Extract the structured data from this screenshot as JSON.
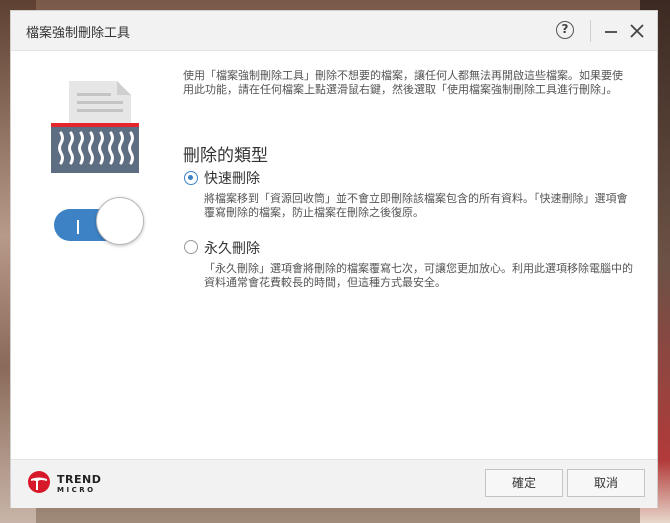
{
  "window": {
    "title": "檔案強制刪除工具"
  },
  "titlebar": {
    "help_glyph": "?",
    "icons": [
      "help-icon",
      "minimize-icon",
      "close-icon"
    ]
  },
  "intro_text": "使用「檔案強制刪除工具」刪除不想要的檔案，讓任何人都無法再開啟這些檔案。如果要使用此功能，請在任何檔案上點選滑鼠右鍵，然後選取「使用檔案強制刪除工具進行刪除」。",
  "deletion_type": {
    "heading": "刪除的類型",
    "options": [
      {
        "label": "快速刪除",
        "description": "將檔案移到「資源回收筒」並不會立即刪除該檔案包含的所有資料。「快速刪除」選項會覆寫刪除的檔案，防止檔案在刪除之後復原。",
        "selected": true
      },
      {
        "label": "永久刪除",
        "description": "「永久刪除」選項會將刪除的檔案覆寫七次，可讓您更加放心。利用此選項移除電腦中的資料通常會花費較長的時間，但這種方式最安全。",
        "selected": false
      }
    ]
  },
  "toggle": {
    "state": "on",
    "color": "#3e82c6"
  },
  "footer": {
    "brand_line1": "TREND",
    "brand_line2": "MICRO",
    "ok_label": "確定",
    "cancel_label": "取消"
  },
  "colors": {
    "accent": "#3e82c6",
    "brand_red": "#d7182a",
    "shredder_red": "#e3262c"
  }
}
